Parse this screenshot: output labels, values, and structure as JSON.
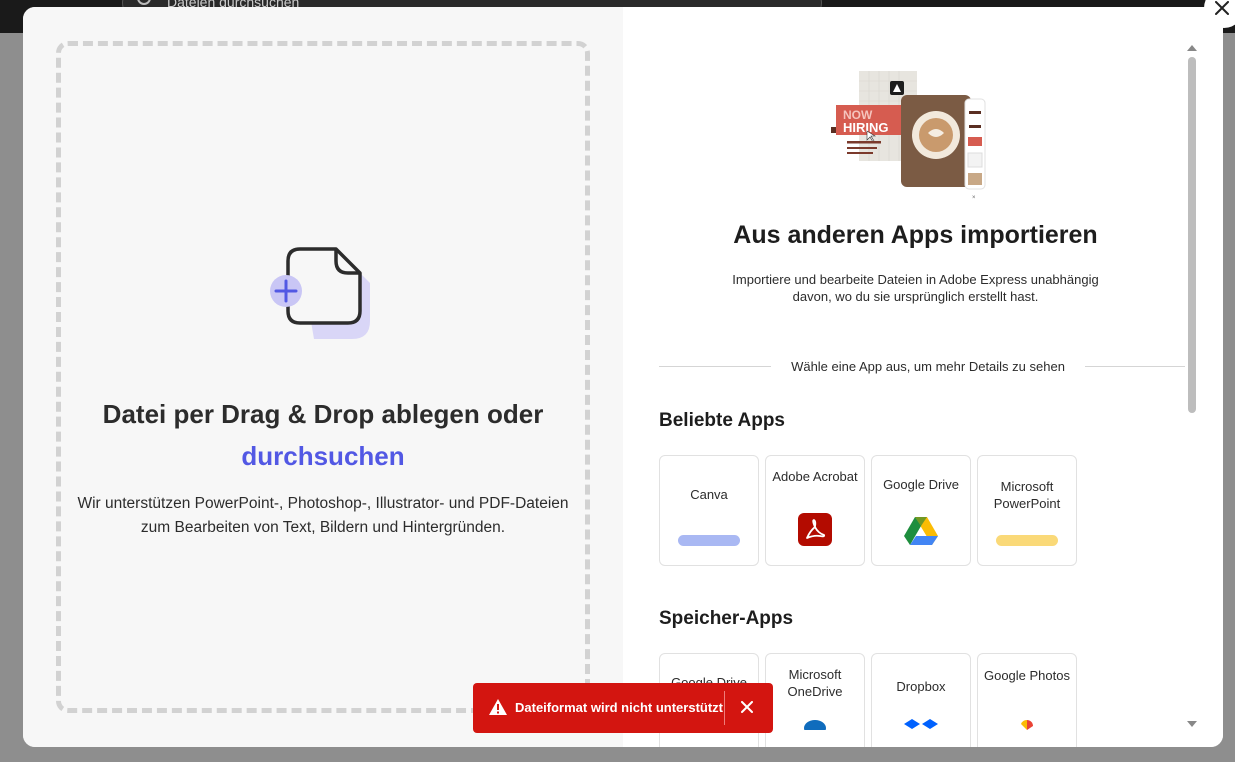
{
  "background": {
    "search_placeholder": "Dateien durchsuchen"
  },
  "dropzone": {
    "title_main": "Datei per Drag & Drop ablegen oder",
    "title_link": "durchsuchen",
    "description": "Wir unterstützen PowerPoint-, Photoshop-, Illustrator- und PDF-Dateien zum Bearbeiten von Text, Bildern und Hintergründen."
  },
  "import": {
    "title": "Aus anderen Apps importieren",
    "description": "Importiere und bearbeite Dateien in Adobe Express unabhängig davon, wo du sie ursprünglich erstellt hast.",
    "divider_text": "Wähle eine App aus, um mehr Details zu sehen",
    "hero_badge_line1": "NOW",
    "hero_badge_line2": "HIRING"
  },
  "popular_apps": {
    "title": "Beliebte Apps",
    "items": [
      {
        "label": "Canva",
        "icon": "canva-logo-icon",
        "color": "#a9b8f3"
      },
      {
        "label": "Adobe Acrobat",
        "icon": "acrobat-logo-icon",
        "color": "#b30b00"
      },
      {
        "label": "Google Drive",
        "icon": "google-drive-logo-icon",
        "color": "#1e8e3e"
      },
      {
        "label": "Microsoft PowerPoint",
        "icon": "powerpoint-logo-icon",
        "color": "#fad978"
      }
    ]
  },
  "storage_apps": {
    "title": "Speicher-Apps",
    "items": [
      {
        "label": "Google Drive",
        "icon": "google-drive-logo-icon"
      },
      {
        "label": "Microsoft OneDrive",
        "icon": "onedrive-logo-icon"
      },
      {
        "label": "Dropbox",
        "icon": "dropbox-logo-icon"
      },
      {
        "label": "Google Photos",
        "icon": "google-photos-logo-icon"
      }
    ]
  },
  "toast": {
    "message": "Dateiformat wird nicht unterstützt",
    "color": "#d31510"
  },
  "colors": {
    "accent_link": "#5258e4"
  }
}
